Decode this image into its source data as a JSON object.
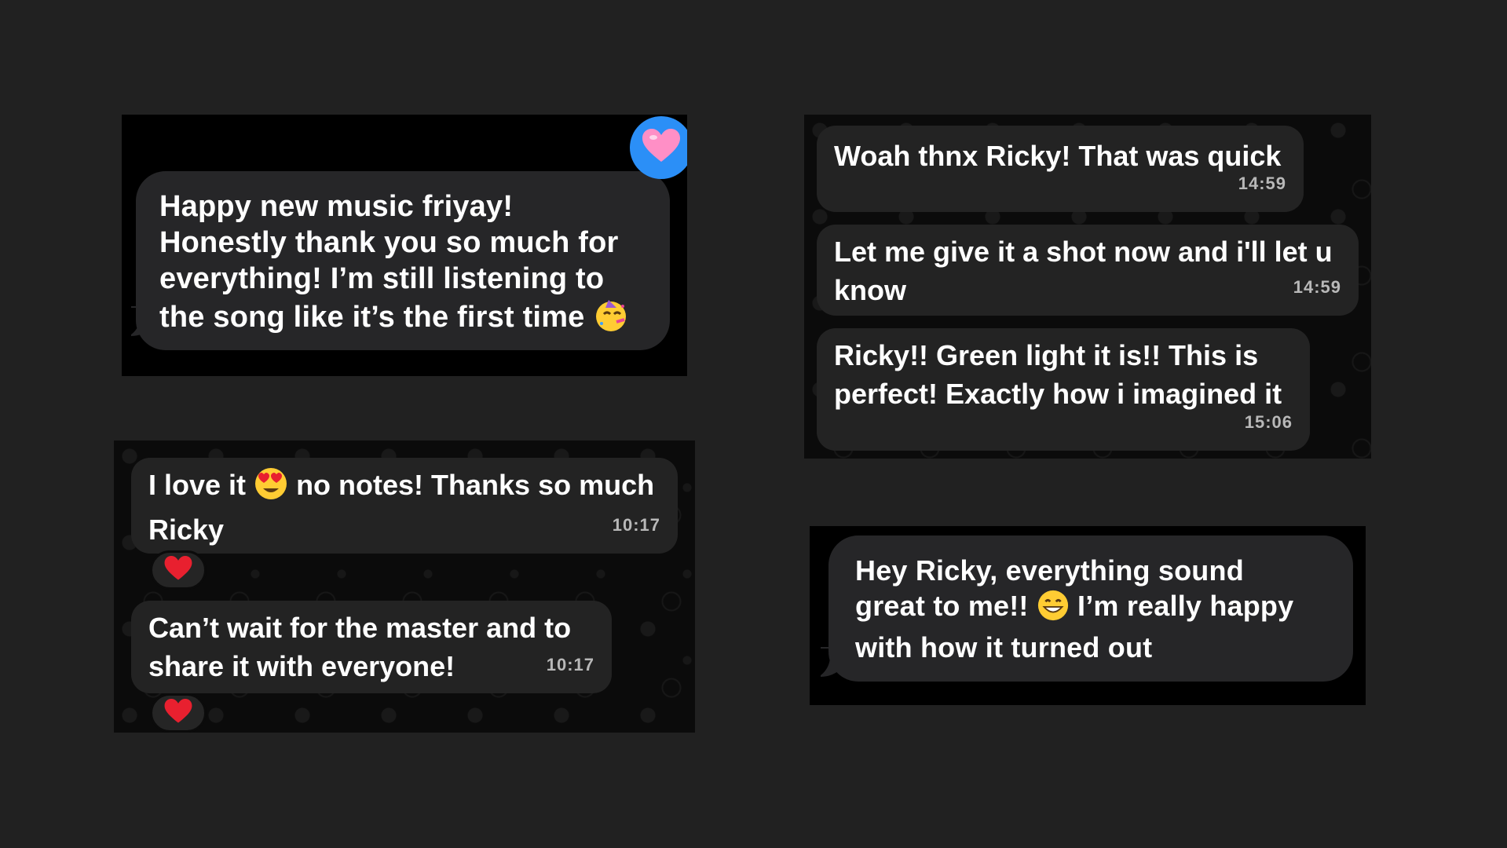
{
  "panel_top_left": {
    "tapback_icon": "pink-heart-icon",
    "message_lines": [
      "Happy new music friyay!",
      "Honestly thank you so much for",
      "everything! I’m still listening to",
      "the song like it’s the first time"
    ],
    "message_emoji": "partying-face-emoji"
  },
  "panel_top_right": {
    "messages": [
      {
        "text": "Woah thnx Ricky! That was quick",
        "time": "14:59"
      },
      {
        "text": "Let me give it a shot now and i'll let u know",
        "time": "14:59"
      },
      {
        "text": "Ricky!! Green light it is!! This is perfect! Exactly how i imagined it",
        "time": "15:06"
      }
    ]
  },
  "panel_bottom_left": {
    "messages": [
      {
        "text_before_emoji": "I love it",
        "emoji": "heart-eyes-emoji",
        "text_after_emoji": "no notes! Thanks so much Ricky",
        "time": "10:17",
        "reaction": "red-heart-icon"
      },
      {
        "text": "Can’t wait for the master and to share it with everyone!",
        "time": "10:17",
        "reaction": "red-heart-icon"
      }
    ]
  },
  "panel_bottom_right": {
    "message_parts": {
      "line1": "Hey Ricky, everything sound",
      "line2_before_emoji": "great to me!!",
      "line2_emoji": "grinning-face-emoji",
      "line2_after_emoji": "I’m really happy",
      "line3": "with how it turned out"
    }
  },
  "colors": {
    "background": "#212121",
    "bubble": "#262628",
    "tapback_blue": "#2b8ff7",
    "heart_red": "#e8202f",
    "heart_pink": "#ff8fc6",
    "timestamp": "#b8b8b8"
  }
}
